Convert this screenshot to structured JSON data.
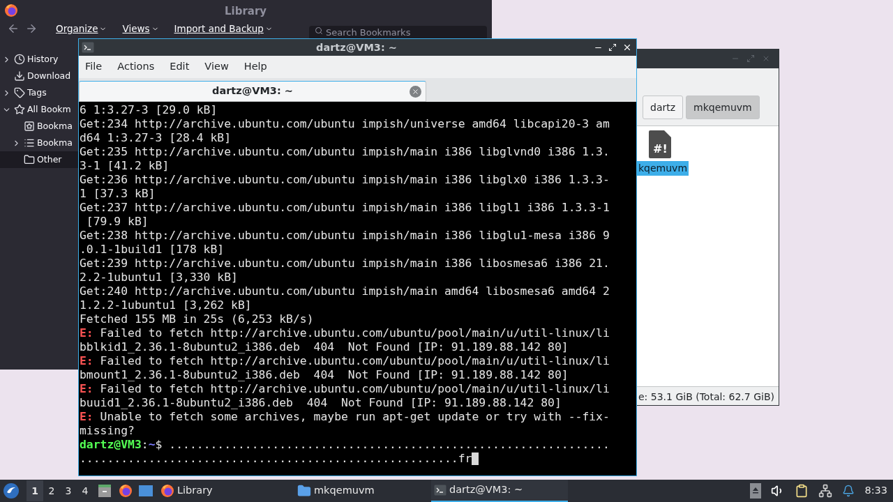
{
  "library": {
    "title": "Library",
    "toolbar": {
      "menus": [
        {
          "label": "Organize"
        },
        {
          "label": "Views"
        },
        {
          "label": "Import and Backup"
        }
      ],
      "search": {
        "placeholder": "Search Bookmarks"
      }
    },
    "tree": [
      {
        "label": "History",
        "kind": "clock",
        "expanded": false,
        "selected": false
      },
      {
        "label": "Download",
        "kind": "download",
        "selected": false
      },
      {
        "label": "Tags",
        "kind": "tag",
        "expanded": false,
        "selected": false
      },
      {
        "label": "All Bookm",
        "kind": "star",
        "expanded": true,
        "selected": false,
        "children": [
          {
            "label": "Bookma",
            "kind": "starbox",
            "selected": false
          },
          {
            "label": "Bookma",
            "kind": "list",
            "expanded": false,
            "selected": false
          },
          {
            "label": "Other",
            "kind": "folder",
            "selected": true
          }
        ]
      }
    ]
  },
  "terminal": {
    "title": "dartz@VM3: ~",
    "menu": [
      "File",
      "Actions",
      "Edit",
      "View",
      "Help"
    ],
    "tabs": [
      {
        "label": "dartz@VM3: ~",
        "selected": true
      }
    ],
    "lines": [
      {
        "kind": "plain",
        "text": "6 1:3.27-3 [29.0 kB]"
      },
      {
        "kind": "plain",
        "text": "Get:234 http://archive.ubuntu.com/ubuntu impish/universe amd64 libcapi20-3 am"
      },
      {
        "kind": "plain",
        "text": "d64 1:3.27-3 [28.4 kB]"
      },
      {
        "kind": "plain",
        "text": "Get:235 http://archive.ubuntu.com/ubuntu impish/main i386 libglvnd0 i386 1.3."
      },
      {
        "kind": "plain",
        "text": "3-1 [41.2 kB]"
      },
      {
        "kind": "plain",
        "text": "Get:236 http://archive.ubuntu.com/ubuntu impish/main i386 libglx0 i386 1.3.3-"
      },
      {
        "kind": "plain",
        "text": "1 [37.3 kB]"
      },
      {
        "kind": "plain",
        "text": "Get:237 http://archive.ubuntu.com/ubuntu impish/main i386 libgl1 i386 1.3.3-1"
      },
      {
        "kind": "plain",
        "text": " [79.9 kB]"
      },
      {
        "kind": "plain",
        "text": "Get:238 http://archive.ubuntu.com/ubuntu impish/main i386 libglu1-mesa i386 9"
      },
      {
        "kind": "plain",
        "text": ".0.1-1build1 [178 kB]"
      },
      {
        "kind": "plain",
        "text": "Get:239 http://archive.ubuntu.com/ubuntu impish/main i386 libosmesa6 i386 21."
      },
      {
        "kind": "plain",
        "text": "2.2-1ubuntu1 [3,330 kB]"
      },
      {
        "kind": "plain",
        "text": "Get:240 http://archive.ubuntu.com/ubuntu impish/main amd64 libosmesa6 amd64 2"
      },
      {
        "kind": "plain",
        "text": "1.2.2-1ubuntu1 [3,262 kB]"
      },
      {
        "kind": "plain",
        "text": "Fetched 155 MB in 25s (6,253 kB/s)"
      },
      {
        "kind": "error",
        "tag": "E:",
        "text": " Failed to fetch http://archive.ubuntu.com/ubuntu/pool/main/u/util-linux/li"
      },
      {
        "kind": "plain",
        "text": "bblkid1_2.36.1-8ubuntu2_i386.deb  404  Not Found [IP: 91.189.88.142 80]"
      },
      {
        "kind": "error",
        "tag": "E:",
        "text": " Failed to fetch http://archive.ubuntu.com/ubuntu/pool/main/u/util-linux/li"
      },
      {
        "kind": "plain",
        "text": "bmount1_2.36.1-8ubuntu2_i386.deb  404  Not Found [IP: 91.189.88.142 80]"
      },
      {
        "kind": "error",
        "tag": "E:",
        "text": " Failed to fetch http://archive.ubuntu.com/ubuntu/pool/main/u/util-linux/li"
      },
      {
        "kind": "plain",
        "text": "buuid1_2.36.1-8ubuntu2_i386.deb  404  Not Found [IP: 91.189.88.142 80]"
      },
      {
        "kind": "error",
        "tag": "E:",
        "text": " Unable to fetch some archives, maybe run apt-get update or try with --fix-"
      },
      {
        "kind": "plain",
        "text": "missing?"
      },
      {
        "kind": "prompt",
        "user": "dartz@VM3",
        "sep": ":",
        "path": "~",
        "text": "$ ................................................................"
      },
      {
        "kind": "plain",
        "text": ".......................................................fr"
      }
    ],
    "cursor": true
  },
  "file_manager": {
    "path_buttons": [
      {
        "label": "dartz",
        "selected": false
      },
      {
        "label": "mkqemuvm",
        "selected": true
      }
    ],
    "files": [
      {
        "name": "kqemuvm",
        "icon_text": "#!",
        "selected": true
      }
    ],
    "status": "e: 53.1 GiB (Total: 62.7 GiB)"
  },
  "taskbar": {
    "desktops": [
      {
        "label": "1",
        "selected": true
      },
      {
        "label": "2",
        "selected": false
      },
      {
        "label": "3",
        "selected": false
      },
      {
        "label": "4",
        "selected": false
      }
    ],
    "tasks": [
      {
        "label": "Library",
        "kind": "browser",
        "selected": false
      },
      {
        "label": "mkqemuvm",
        "kind": "folder",
        "selected": false
      },
      {
        "label": "dartz@VM3: ~",
        "kind": "terminal",
        "selected": true
      }
    ],
    "clock": "8:33"
  }
}
